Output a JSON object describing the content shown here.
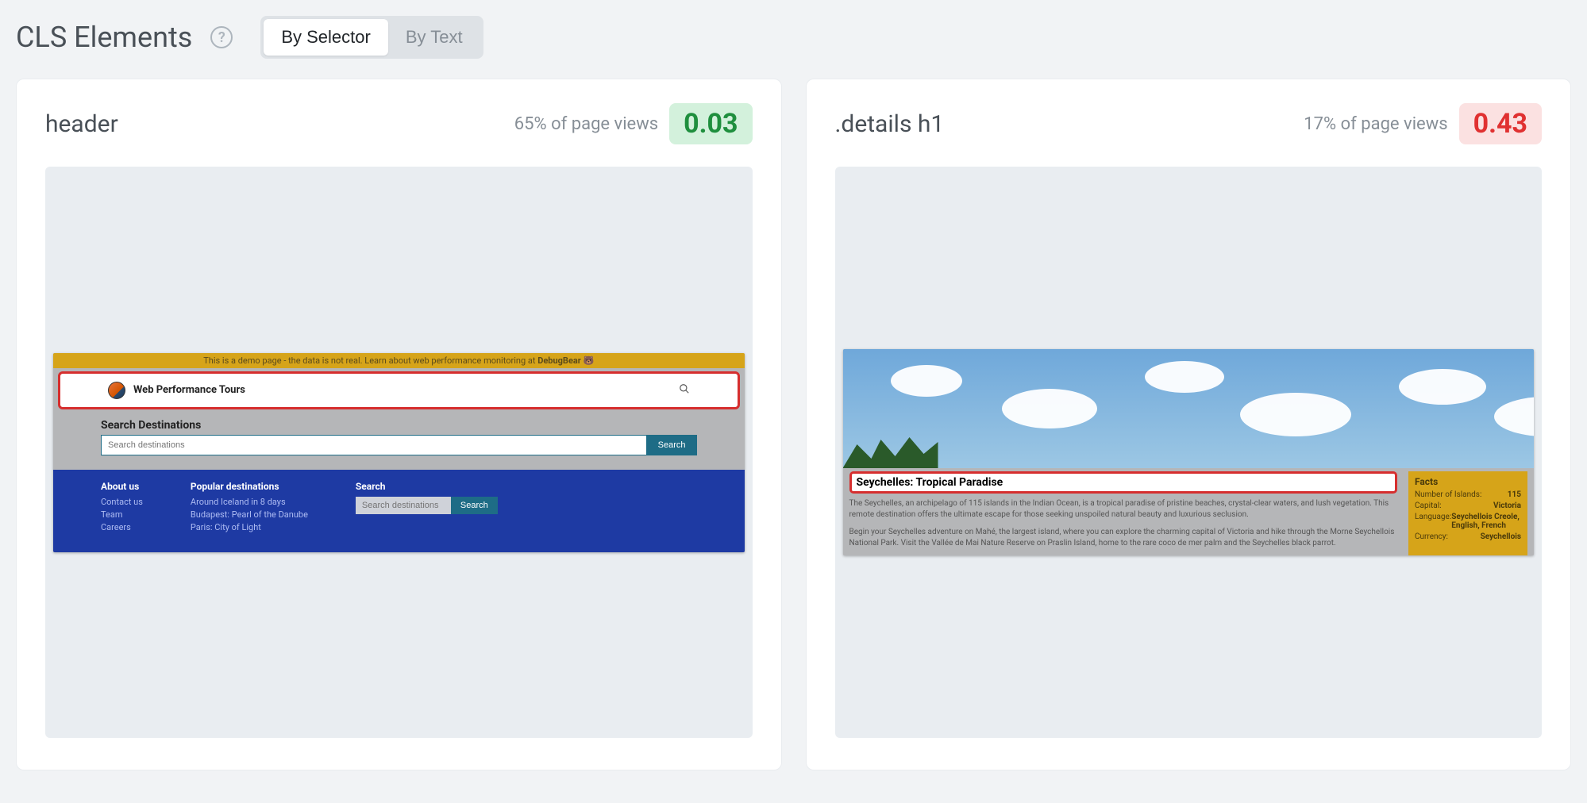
{
  "title": "CLS Elements",
  "toggle": {
    "by_selector": "By Selector",
    "by_text": "By Text"
  },
  "cards": [
    {
      "selector": "header",
      "pageviews": "65% of page views",
      "score": "0.03",
      "score_class": "good",
      "preview": {
        "banner_text": "This is a demo page - the data is not real. Learn about web performance monitoring at",
        "banner_link": "DebugBear",
        "logo_text": "Web Performance Tours",
        "search_label": "Search Destinations",
        "search_placeholder": "Search destinations",
        "search_button": "Search",
        "footer": {
          "about": {
            "title": "About us",
            "links": [
              "Contact us",
              "Team",
              "Careers"
            ]
          },
          "popular": {
            "title": "Popular destinations",
            "links": [
              "Around Iceland in 8 days",
              "Budapest: Pearl of the Danube",
              "Paris: City of Light"
            ]
          },
          "search": {
            "title": "Search",
            "placeholder": "Search destinations",
            "button": "Search"
          }
        }
      }
    },
    {
      "selector": ".details h1",
      "pageviews": "17% of page views",
      "score": "0.43",
      "score_class": "bad",
      "preview": {
        "heading": "Seychelles: Tropical Paradise",
        "para1": "The Seychelles, an archipelago of 115 islands in the Indian Ocean, is a tropical paradise of pristine beaches, crystal-clear waters, and lush vegetation. This remote destination offers the ultimate escape for those seeking unspoiled natural beauty and luxurious seclusion.",
        "para2": "Begin your Seychelles adventure on Mahé, the largest island, where you can explore the charming capital of Victoria and hike through the Morne Seychellois National Park. Visit the Vallée de Mai Nature Reserve on Praslin Island, home to the rare coco de mer palm and the Seychelles black parrot.",
        "facts": {
          "title": "Facts",
          "rows": [
            {
              "label": "Number of Islands:",
              "value": "115"
            },
            {
              "label": "Capital:",
              "value": "Victoria"
            },
            {
              "label": "Language:",
              "value": "Seychellois Creole, English, French"
            },
            {
              "label": "Currency:",
              "value": "Seychellois"
            }
          ]
        }
      }
    }
  ]
}
